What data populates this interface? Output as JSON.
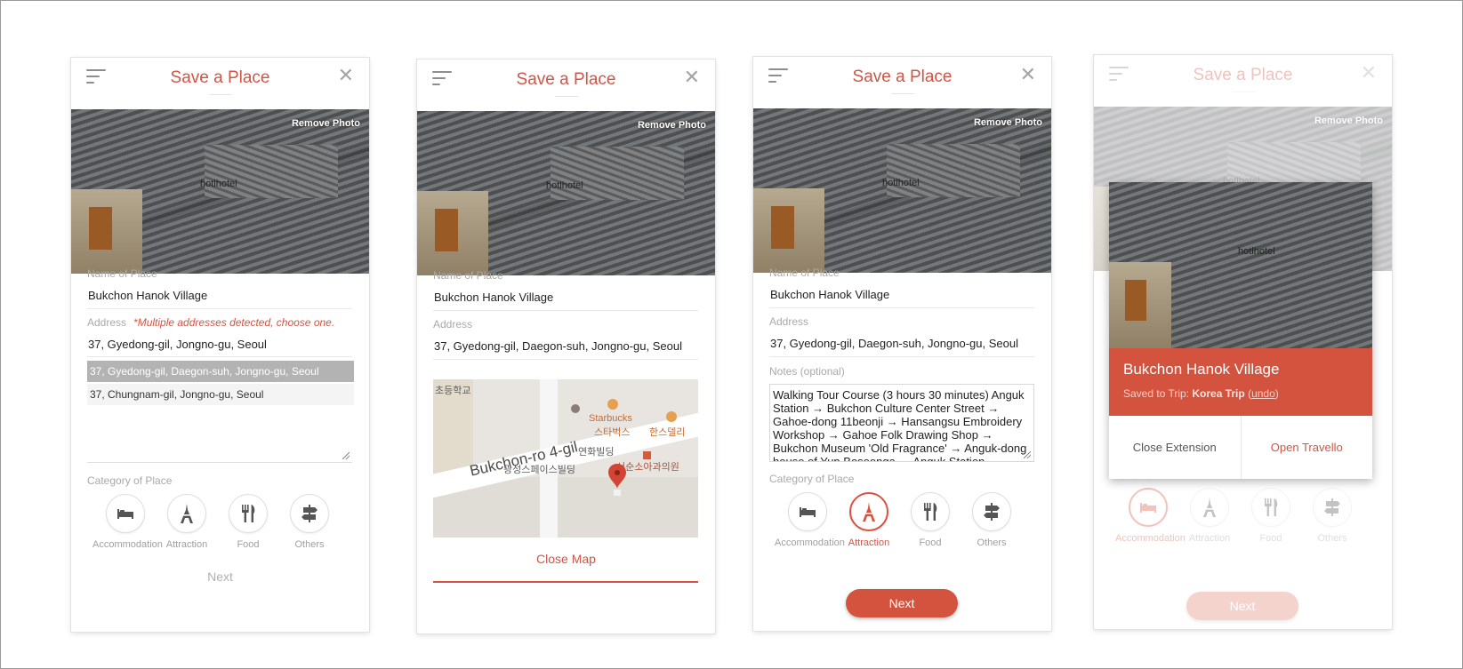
{
  "header": {
    "title": "Save a Place",
    "close_glyph": "✕"
  },
  "photo": {
    "remove_label": "Remove Photo",
    "watermark": "hotlhotel"
  },
  "fields": {
    "name_label": "Name of Place",
    "name_value": "Bukchon Hanok Village",
    "address_label": "Address",
    "notes_label": "Notes (optional)",
    "category_label": "Category of Place"
  },
  "panel1": {
    "address_warning": "*Multiple addresses detected, choose one.",
    "address_value": "37, Gyedong-gil, Jongno-gu, Seoul",
    "options": [
      "37, Gyedong-gil, Daegon-suh, Jongno-gu, Seoul",
      "37, Chungnam-gil, Jongno-gu, Seoul"
    ],
    "next_label": "Next"
  },
  "panel2": {
    "address_value": "37, Gyedong-gil, Daegon-suh, Jongno-gu, Seoul",
    "map": {
      "road_label": "Bukchon-ro 4-gil",
      "labels": {
        "school": "초등학교",
        "starbucks_en": "Starbucks",
        "starbucks_ko": "스타벅스",
        "restaurant": "한스델리",
        "building1": "연화빌딩",
        "building2": "광성스페이스빌딩",
        "clinic": "서순소아과의원"
      }
    },
    "close_map_label": "Close Map"
  },
  "panel3": {
    "address_value": "37, Gyedong-gil, Daegon-suh, Jongno-gu, Seoul",
    "notes_value": "Walking Tour Course (3 hours 30 minutes)   Anguk Station → Bukchon Culture Center Street → Gahoe-dong 11beonji → Hansangsu Embroidery Workshop → Gahoe Folk Drawing Shop → Bukchon Museum 'Old Fragrance' → Anguk-dong house of Yun Boseonga → Anguk Station",
    "next_label": "Next"
  },
  "categories": [
    "Accommodation",
    "Attraction",
    "Food",
    "Others"
  ],
  "panel4": {
    "place_name": "Bukchon Hanok Village",
    "saved_prefix": "Saved to Trip: ",
    "trip_name": "Korea Trip",
    "undo_label": "undo",
    "close_extension_label": "Close Extension",
    "open_travello_label": "Open Travello",
    "next_label": "Next"
  },
  "colors": {
    "accent": "#d4533f",
    "title": "#cf5545",
    "muted": "#a9a9a9"
  }
}
